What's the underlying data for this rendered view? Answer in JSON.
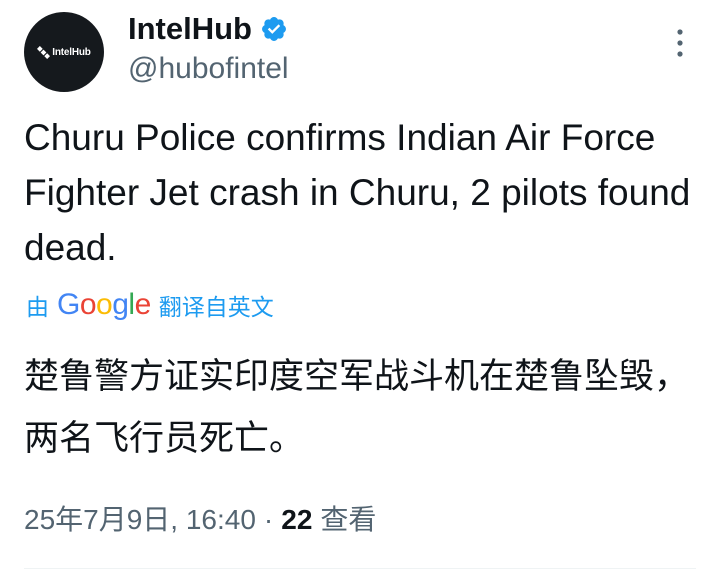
{
  "account": {
    "avatar_text": "IntelHub",
    "display_name": "IntelHub",
    "handle": "@hubofintel",
    "verified": true
  },
  "tweet": {
    "text": "Churu Police confirms Indian Air Force Fighter Jet crash in Churu, 2 pilots found dead."
  },
  "translation": {
    "prefix": "由",
    "provider": "Google",
    "suffix": "翻译自英文",
    "text": "楚鲁警方证实印度空军战斗机在楚鲁坠毁，两名飞行员死亡。"
  },
  "meta": {
    "timestamp": "25年7月9日, 16:40",
    "separator": "·",
    "views_count": "22",
    "views_label": "查看"
  },
  "colors": {
    "link": "#1d9bf0",
    "secondary_text": "#536471",
    "verified_badge": "#1d9bf0"
  },
  "icons": {
    "verified": "verified-badge-icon",
    "more": "more-vertical-icon",
    "avatar_logo": "satellite-icon"
  }
}
